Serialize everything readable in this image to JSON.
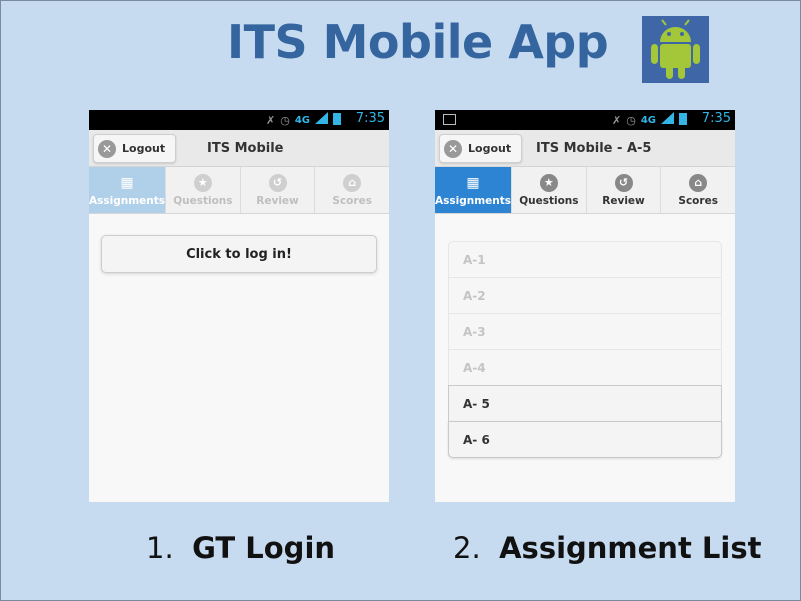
{
  "slide": {
    "title": "ITS Mobile App",
    "captions": [
      {
        "number": "1.",
        "text": "GT Login"
      },
      {
        "number": "2.",
        "text": "Assignment List"
      }
    ]
  },
  "colors": {
    "background": "#c6daf0",
    "title": "#35659f",
    "active_tab": "#2d84d2",
    "android_green": "#a4c639"
  },
  "status_bar": {
    "time": "7:35",
    "network": "4G"
  },
  "phone1": {
    "header": {
      "logout_label": "Logout",
      "title": "ITS Mobile"
    },
    "tabs": [
      {
        "label": "Assignments",
        "icon": "grid-icon",
        "active": true
      },
      {
        "label": "Questions",
        "icon": "star-icon",
        "active": false
      },
      {
        "label": "Review",
        "icon": "refresh-icon",
        "active": false
      },
      {
        "label": "Scores",
        "icon": "home-icon",
        "active": false
      }
    ],
    "login_button": "Click to log in!"
  },
  "phone2": {
    "header": {
      "logout_label": "Logout",
      "title": "ITS Mobile - A-5"
    },
    "tabs": [
      {
        "label": "Assignments",
        "icon": "grid-icon",
        "active": true
      },
      {
        "label": "Questions",
        "icon": "star-icon",
        "active": false
      },
      {
        "label": "Review",
        "icon": "refresh-icon",
        "active": false
      },
      {
        "label": "Scores",
        "icon": "home-icon",
        "active": false
      }
    ],
    "assignments": [
      {
        "label": "A-1",
        "enabled": false
      },
      {
        "label": "A-2",
        "enabled": false
      },
      {
        "label": "A-3",
        "enabled": false
      },
      {
        "label": "A-4",
        "enabled": false
      },
      {
        "label": "A- 5",
        "enabled": true
      },
      {
        "label": "A- 6",
        "enabled": true
      }
    ]
  }
}
